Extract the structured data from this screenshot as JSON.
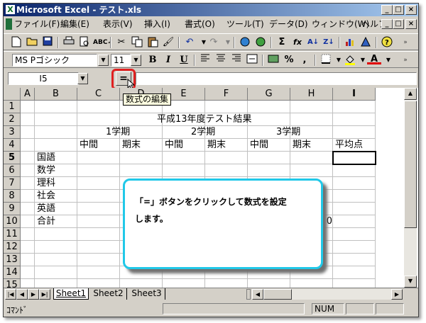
{
  "window": {
    "title": "Microsoft Excel - テスト.xls",
    "app_icon": "X",
    "caption_buttons": [
      "_",
      "□",
      "×"
    ],
    "doc_buttons": [
      "_",
      "□",
      "×"
    ]
  },
  "menu": {
    "items": [
      "ファイル(F)",
      "編集(E)",
      "表示(V)",
      "挿入(I)",
      "書式(O)",
      "ツール(T)",
      "データ(D)",
      "ウィンドウ(W)",
      "ヘルプ(H)"
    ]
  },
  "toolbar": {
    "icons": [
      "new-document-icon",
      "open-folder-icon",
      "save-icon",
      "print-icon",
      "print-preview-icon",
      "spelling-icon",
      "cut-icon",
      "copy-icon",
      "paste-icon",
      "format-painter-icon",
      "undo-icon",
      "redo-icon",
      "hyperlink-icon",
      "web-toolbar-icon",
      "autosum-icon",
      "function-icon",
      "sort-ascending-icon",
      "sort-descending-icon",
      "chart-wizard-icon",
      "drawing-icon",
      "help-icon"
    ],
    "glyphs": {
      "autosum": "Σ",
      "function": "fx",
      "sort_asc": "A↓",
      "sort_desc": "Z↓"
    }
  },
  "format_toolbar": {
    "font": "MS Pゴシック",
    "size": "11",
    "bold": "B",
    "italic": "I",
    "underline": "U",
    "percent": "%",
    "comma": ",",
    "font_color_glyph": "A"
  },
  "formula_bar": {
    "name_box": "I5",
    "equals_label": "=",
    "tooltip": "数式の編集"
  },
  "columns": [
    "A",
    "B",
    "C",
    "D",
    "E",
    "F",
    "G",
    "H",
    "I"
  ],
  "rows": [
    "1",
    "2",
    "3",
    "4",
    "5",
    "6",
    "7",
    "8",
    "9",
    "10",
    "11",
    "12",
    "13",
    "14",
    "15"
  ],
  "sheet": {
    "title": "平成13年度テスト結果",
    "term1": "1学期",
    "term2": "2学期",
    "term3": "3学期",
    "mid1": "中間",
    "fin1": "期末",
    "mid2": "中間",
    "fin2": "期末",
    "mid3": "中間",
    "fin3": "期末",
    "average": "平均点",
    "subjects": [
      "国語",
      "数学",
      "理科",
      "社会",
      "英語",
      "合計"
    ],
    "total_h10": "0"
  },
  "callout": {
    "line1": "「=」ボタンをクリックして数式を設定",
    "line2": "します。"
  },
  "sheet_tabs": [
    "Sheet1",
    "Sheet2",
    "Sheet3"
  ],
  "status": {
    "mode": "ｺﾏﾝﾄﾞ",
    "num": "NUM"
  }
}
